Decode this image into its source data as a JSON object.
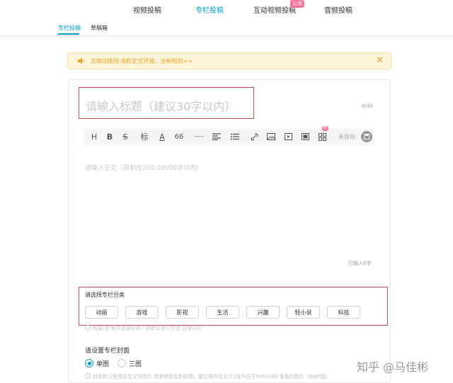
{
  "topnav": {
    "tabs": [
      {
        "label": "视频投稿"
      },
      {
        "label": "专栏投稿"
      },
      {
        "label": "互动视频投稿"
      },
      {
        "label": "音频投稿"
      }
    ],
    "badge": "公测",
    "active_color": "#00a1d6"
  },
  "subnav": {
    "tabs": [
      {
        "label": "专栏投稿"
      },
      {
        "label": "草稿箱"
      }
    ]
  },
  "notice": {
    "text": "文章试炼场 高阶正式开放，全新规则>>",
    "close": "✕"
  },
  "editor": {
    "title_placeholder": "请输入标题（建议30字以内）",
    "title_counter": "0/40",
    "toolbar": {
      "heading": "H",
      "bold": "B",
      "strike": "S",
      "tag": "标",
      "font_color": "A",
      "quote": "66",
      "divider": "----",
      "new_badge": "新",
      "unsaved": "未保存"
    },
    "body_placeholder": "请输入正文（限制在200-20000字以内）",
    "word_count": "已输入0字"
  },
  "category": {
    "label": "请选择专栏分类",
    "options": [
      "动画",
      "游戏",
      "影视",
      "生活",
      "兴趣",
      "轻小说",
      "科技"
    ],
    "hint": "转载/选 有不选择分类，则默认进入生活-日常分区"
  },
  "cover": {
    "label": "请设置专栏封面",
    "options": [
      "单图",
      "三图"
    ],
    "selected": "单图",
    "hint": "封面默认使用正文文字图片 若需使用定制单图，整文需存在至少1张不低于640x188 像素的图片（Bigif图）"
  },
  "watermark": "知乎 @马佳彬",
  "colors": {
    "accent": "#00a1d6",
    "highlight_box": "#c0504d",
    "notice_bg": "#fff5db",
    "notice_text": "#f0a020"
  }
}
